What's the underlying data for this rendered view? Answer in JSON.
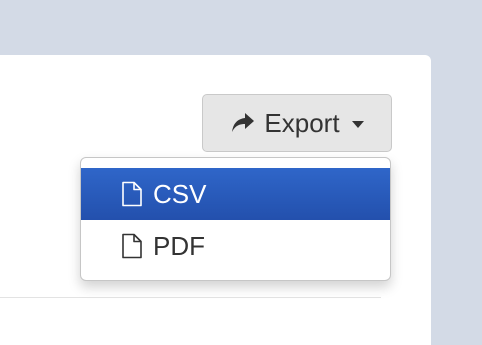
{
  "export_button": {
    "label": "Export",
    "icon": "share-icon"
  },
  "export_menu": {
    "items": [
      {
        "label": "CSV",
        "icon": "file-icon",
        "active": true
      },
      {
        "label": "PDF",
        "icon": "file-icon",
        "active": false
      }
    ]
  },
  "colors": {
    "page_background": "#d3dae6",
    "panel_background": "#ffffff",
    "button_background": "#e6e6e6",
    "active_item": "#2a5bbd",
    "text": "#333333"
  }
}
